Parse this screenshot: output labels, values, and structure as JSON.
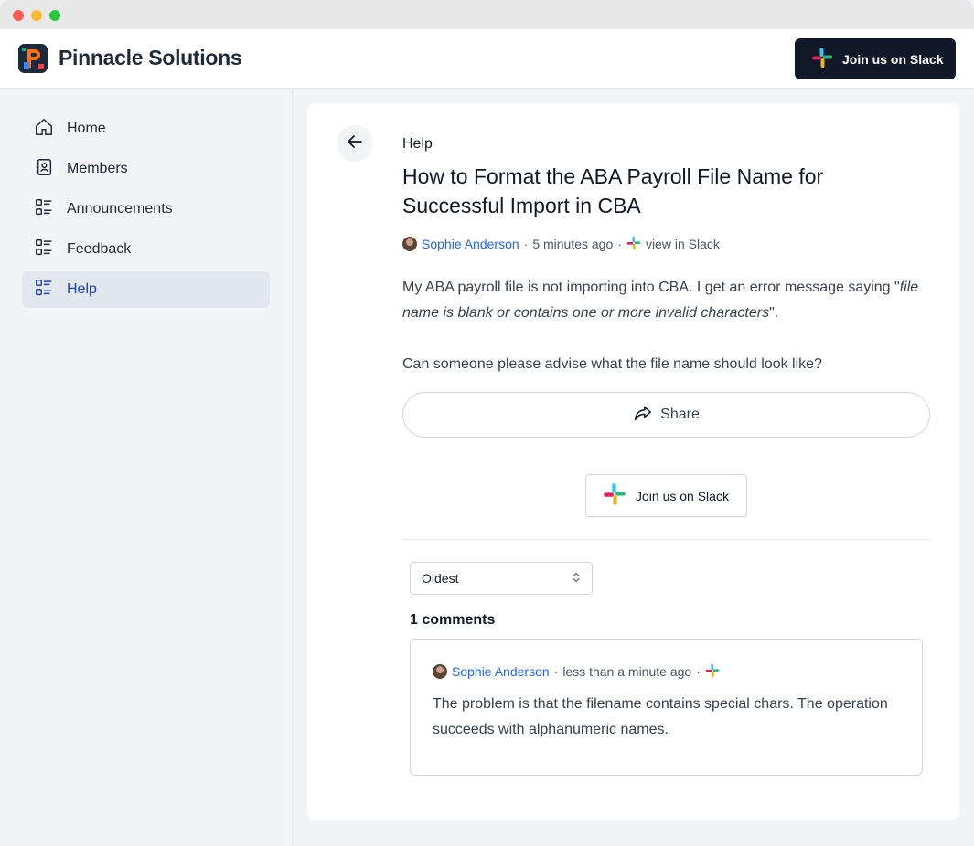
{
  "app": {
    "brand_name": "Pinnacle Solutions",
    "slack_cta": "Join us on Slack"
  },
  "sidebar": {
    "items": [
      {
        "label": "Home",
        "icon": "home-icon",
        "active": false
      },
      {
        "label": "Members",
        "icon": "address-book-icon",
        "active": false
      },
      {
        "label": "Announcements",
        "icon": "list-icon",
        "active": false
      },
      {
        "label": "Feedback",
        "icon": "list-icon",
        "active": false
      },
      {
        "label": "Help",
        "icon": "list-icon",
        "active": true
      }
    ]
  },
  "post": {
    "section": "Help",
    "title": "How to Format the ABA Payroll File Name for Successful Import in CBA",
    "author": "Sophie Anderson",
    "time": "5 minutes ago",
    "view_link": "view in Slack",
    "body_intro": "My ABA payroll file is not importing into CBA. I get an error message saying \"",
    "body_error": "file name is blank or contains one or more invalid characters",
    "body_outro": "\".",
    "body_question": "Can someone please advise what the file name should look like?",
    "share_label": "Share",
    "slack_cta": "Join us on Slack"
  },
  "comments": {
    "sort_value": "Oldest",
    "count_label": "1 comments",
    "items": [
      {
        "author": "Sophie Anderson",
        "time": "less than a minute ago",
        "text": "The problem is that the filename contains special chars. The operation succeeds with alphanumeric names."
      }
    ]
  },
  "colors": {
    "accent_link": "#2563eb",
    "active_nav_bg": "#e2e8f0",
    "dark_button": "#111827"
  }
}
